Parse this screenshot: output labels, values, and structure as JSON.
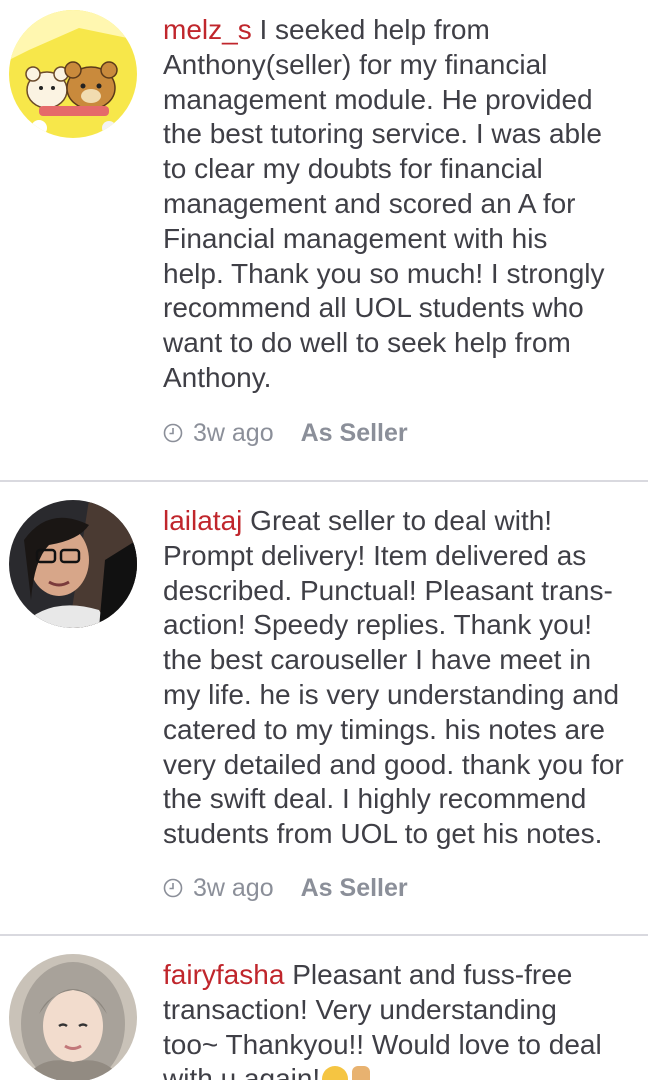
{
  "reviews": [
    {
      "username": "melz_s",
      "lines": [
        "I seeked help from",
        "Anthony(seller) for my financial",
        "management module. He provided",
        "the best tutoring service. I was able",
        "to clear my doubts for financial",
        "management and scored an A for",
        "Financial management with his",
        "help. Thank you so much! I strongly",
        "recommend all UOL students who",
        "want to do well to seek help from",
        "Anthony."
      ],
      "time": "3w ago",
      "role": "As Seller",
      "avatar": "bear-avatar-icon"
    },
    {
      "username": "lailataj",
      "lines": [
        "Great seller to deal with!",
        "Prompt delivery! Item delivered as",
        "described. Punctual! Pleasant trans-",
        "action! Speedy replies. Thank you!",
        "the best carouseller I have meet in",
        "my life. he is very understanding and",
        "catered to my timings. his notes are",
        "very detailed and good. thank you for",
        "the swift deal. I highly recommend",
        "students from UOL to get his notes."
      ],
      "time": "3w ago",
      "role": "As Seller",
      "avatar": "user-photo-avatar"
    },
    {
      "username": "fairyfasha",
      "lines": [
        "Pleasant and fuss-free",
        "transaction! Very understanding",
        "too~ Thankyou!! Would love to deal",
        "with u again!"
      ],
      "time": "",
      "role": "",
      "avatar": "user-photo-avatar"
    }
  ],
  "colors": {
    "username": "#c0262c",
    "text": "#3f3f46",
    "meta": "#8b8f99",
    "divider": "#d9d9df"
  }
}
